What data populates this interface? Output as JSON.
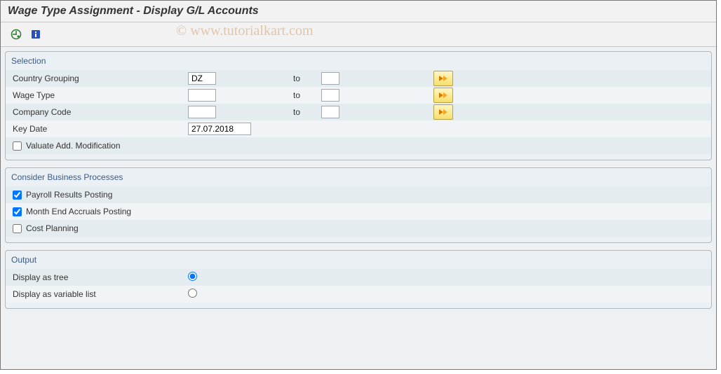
{
  "header": {
    "title": "Wage Type Assignment - Display G/L Accounts"
  },
  "watermark": "© www.tutorialkart.com",
  "selection": {
    "group_title": "Selection",
    "to_word": "to",
    "country_grouping": {
      "label": "Country Grouping",
      "from": "DZ",
      "to": ""
    },
    "wage_type": {
      "label": "Wage Type",
      "from": "",
      "to": ""
    },
    "company_code": {
      "label": "Company Code",
      "from": "",
      "to": ""
    },
    "key_date": {
      "label": "Key Date",
      "value": "27.07.2018"
    },
    "valuate": {
      "label": "Valuate Add. Modification",
      "checked": false
    }
  },
  "processes": {
    "group_title": "Consider Business Processes",
    "payroll": {
      "label": "Payroll Results Posting",
      "checked": true
    },
    "month_end": {
      "label": "Month End Accruals Posting",
      "checked": true
    },
    "cost_plan": {
      "label": "Cost Planning",
      "checked": false
    }
  },
  "output": {
    "group_title": "Output",
    "tree": {
      "label": "Display as tree",
      "selected": true
    },
    "list": {
      "label": "Display as variable list",
      "selected": false
    }
  }
}
